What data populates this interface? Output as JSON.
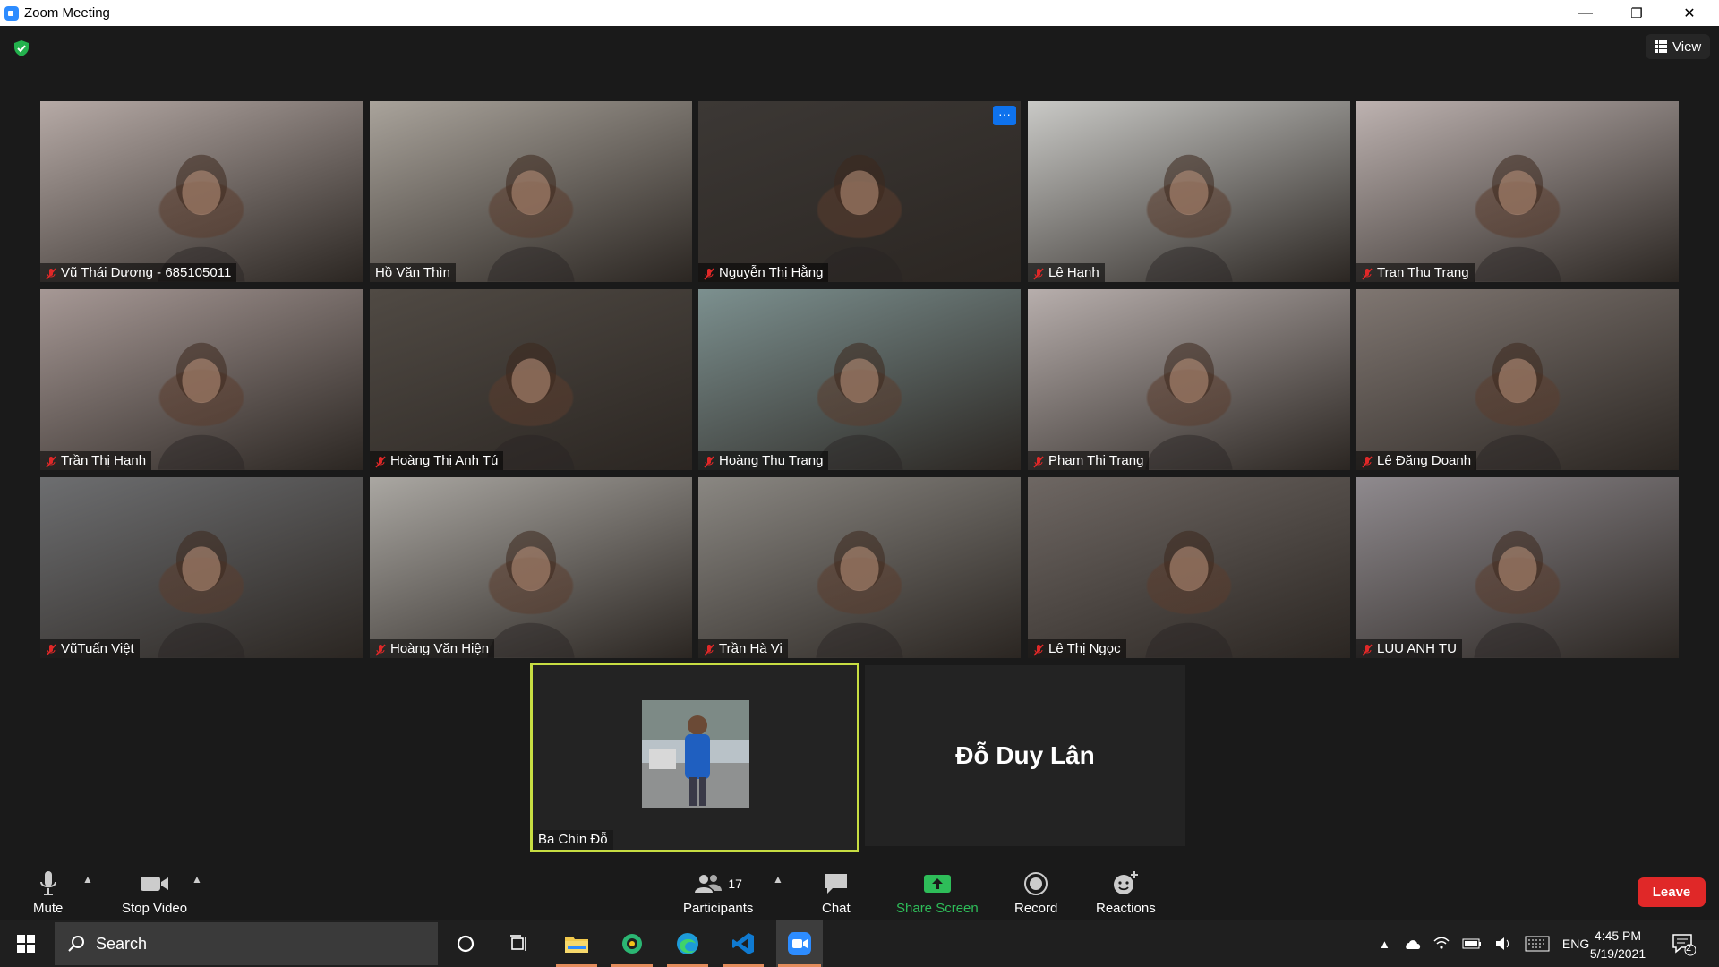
{
  "window": {
    "title": "Zoom Meeting",
    "minimize": "—",
    "restore": "❐",
    "close": "✕"
  },
  "top": {
    "view_label": "View"
  },
  "participants": [
    {
      "name": "Vũ Thái Dương - 685105011",
      "muted": true,
      "bg": "#b6aaa6"
    },
    {
      "name": "Hồ Văn Thìn",
      "muted": false,
      "bg": "#a9a39b"
    },
    {
      "name": "Nguyễn Thị Hằng",
      "muted": true,
      "bg": "#3c3835",
      "more": "···"
    },
    {
      "name": "Lê Hạnh",
      "muted": true,
      "bg": "#c9c9c6"
    },
    {
      "name": "Tran Thu Trang",
      "muted": true,
      "bg": "#bdb2b0"
    },
    {
      "name": "Trần Thị Hạnh",
      "muted": true,
      "bg": "#a69895"
    },
    {
      "name": "Hoàng Thị Anh Tú",
      "muted": true,
      "bg": "#504a44"
    },
    {
      "name": "Hoàng Thu Trang",
      "muted": true,
      "bg": "#7c908f"
    },
    {
      "name": "Pham Thi Trang",
      "muted": true,
      "bg": "#b7aeac"
    },
    {
      "name": "Lê Đăng Doanh",
      "muted": true,
      "bg": "#7f7671"
    },
    {
      "name": "VũTuấn Việt",
      "muted": true,
      "bg": "#6d6e70"
    },
    {
      "name": "Hoàng Văn Hiện",
      "muted": true,
      "bg": "#aaa7a2"
    },
    {
      "name": "Trần Hà Vi",
      "muted": true,
      "bg": "#8a8782"
    },
    {
      "name": "Lê Thị Ngọc",
      "muted": true,
      "bg": "#6e6763"
    },
    {
      "name": "LUU ANH TU",
      "muted": true,
      "bg": "#8f8a8e"
    }
  ],
  "active_speaker": {
    "name": "Ba Chín Đỗ",
    "border_color": "#c7dd42"
  },
  "name_card": {
    "name": "Đỗ Duy Lân"
  },
  "toolbar": {
    "mute": "Mute",
    "stop_video": "Stop Video",
    "participants_count": "17",
    "participants": "Participants",
    "chat": "Chat",
    "share_screen": "Share Screen",
    "record": "Record",
    "reactions": "Reactions",
    "leave": "Leave"
  },
  "taskbar": {
    "search_placeholder": "Search",
    "language": "ENG",
    "time": "4:45 PM",
    "date": "5/19/2021",
    "notification_count": "2"
  },
  "colors": {
    "share_green": "#2ebd59",
    "leave_red": "#e02828",
    "accent_blue": "#0e72ed"
  }
}
